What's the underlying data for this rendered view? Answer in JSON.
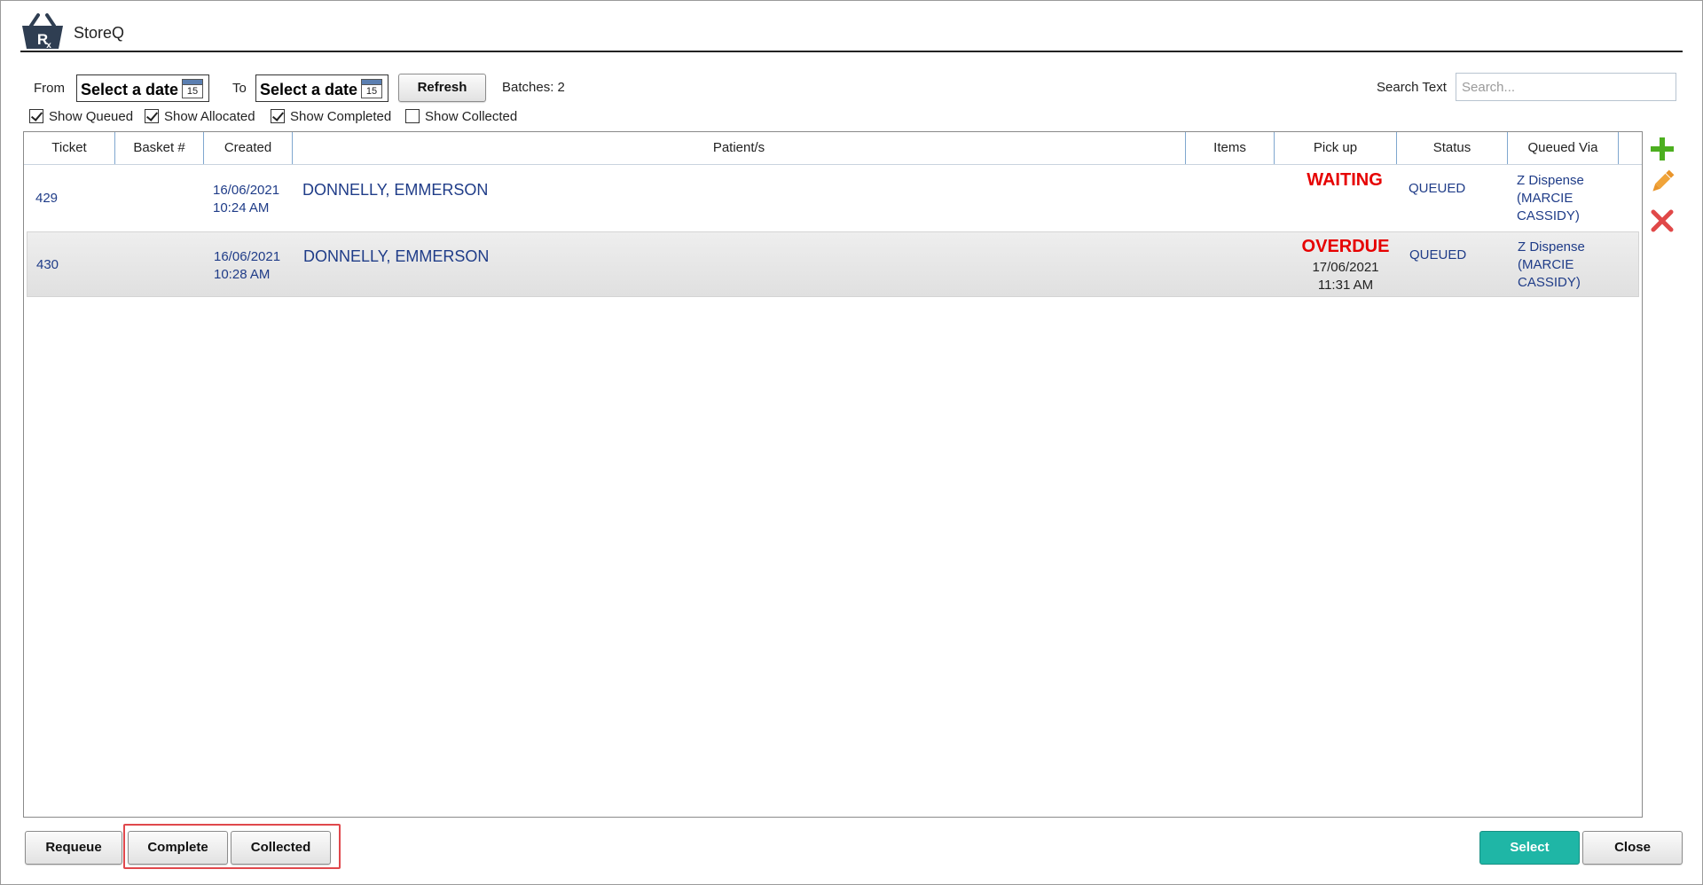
{
  "app": {
    "title": "StoreQ"
  },
  "filters": {
    "from_label": "From",
    "to_label": "To",
    "from_date_placeholder": "Select a date",
    "to_date_placeholder": "Select a date",
    "calendar_day": "15",
    "refresh_label": "Refresh",
    "batches_text": "Batches: 2",
    "search_label": "Search Text",
    "search_placeholder": "Search...",
    "show_queued": {
      "label": "Show Queued",
      "checked": true
    },
    "show_allocated": {
      "label": "Show Allocated",
      "checked": true
    },
    "show_completed": {
      "label": "Show Completed",
      "checked": true
    },
    "show_collected": {
      "label": "Show Collected",
      "checked": false
    }
  },
  "grid": {
    "columns": [
      "Ticket",
      "Basket #",
      "Created",
      "Patient/s",
      "Items",
      "Pick up",
      "Status",
      "Queued Via"
    ],
    "rows": [
      {
        "ticket": "429",
        "basket": "",
        "created_date": "16/06/2021",
        "created_time": "10:24 AM",
        "patient": "DONNELLY, EMMERSON",
        "items": "",
        "pickup_status": "WAITING",
        "pickup_date": "",
        "pickup_time": "",
        "status": "QUEUED",
        "queued_via_1": "Z Dispense",
        "queued_via_2": "(MARCIE",
        "queued_via_3": "CASSIDY)"
      },
      {
        "ticket": "430",
        "basket": "",
        "created_date": "16/06/2021",
        "created_time": "10:28 AM",
        "patient": "DONNELLY, EMMERSON",
        "items": "",
        "pickup_status": "OVERDUE",
        "pickup_date": "17/06/2021",
        "pickup_time": "11:31 AM",
        "status": "QUEUED",
        "queued_via_1": "Z Dispense",
        "queued_via_2": "(MARCIE",
        "queued_via_3": "CASSIDY)"
      }
    ]
  },
  "tools": {
    "add_icon": "plus-icon",
    "edit_icon": "pencil-icon",
    "delete_icon": "close-icon"
  },
  "buttons": {
    "requeue": "Requeue",
    "complete": "Complete",
    "collected": "Collected",
    "select": "Select",
    "close": "Close"
  },
  "colors": {
    "accent": "#1fb6a6",
    "alert": "#e60000",
    "link": "#1f3c88",
    "highlight": "#e0484c"
  }
}
